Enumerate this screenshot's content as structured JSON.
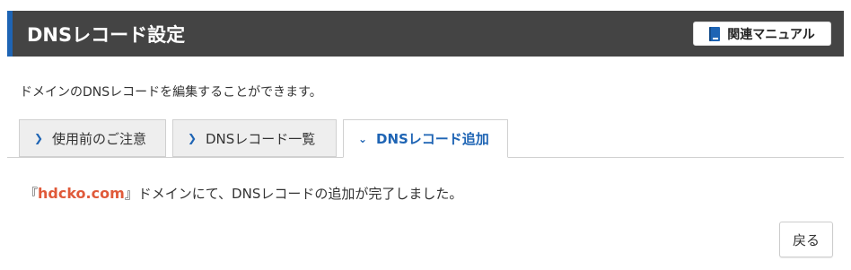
{
  "header": {
    "title": "DNSレコード設定",
    "manual_button_label": "関連マニュアル",
    "manual_icon": "book-icon"
  },
  "description": "ドメインのDNSレコードを編集することができます。",
  "tabs": [
    {
      "label": "使用前のご注意",
      "icon": "chevron-right-icon",
      "active": false
    },
    {
      "label": "DNSレコード一覧",
      "icon": "chevron-right-icon",
      "active": false
    },
    {
      "label": "DNSレコード追加",
      "icon": "chevron-down-icon",
      "active": true
    }
  ],
  "message": {
    "open_bracket": "『",
    "domain": "hdcko.com",
    "close_bracket": "』",
    "text": "ドメインにて、DNSレコードの追加が完了しました。"
  },
  "back_button_label": "戻る",
  "colors": {
    "header_bg": "#444444",
    "accent": "#1e64b4",
    "domain_highlight": "#e05a3a"
  }
}
